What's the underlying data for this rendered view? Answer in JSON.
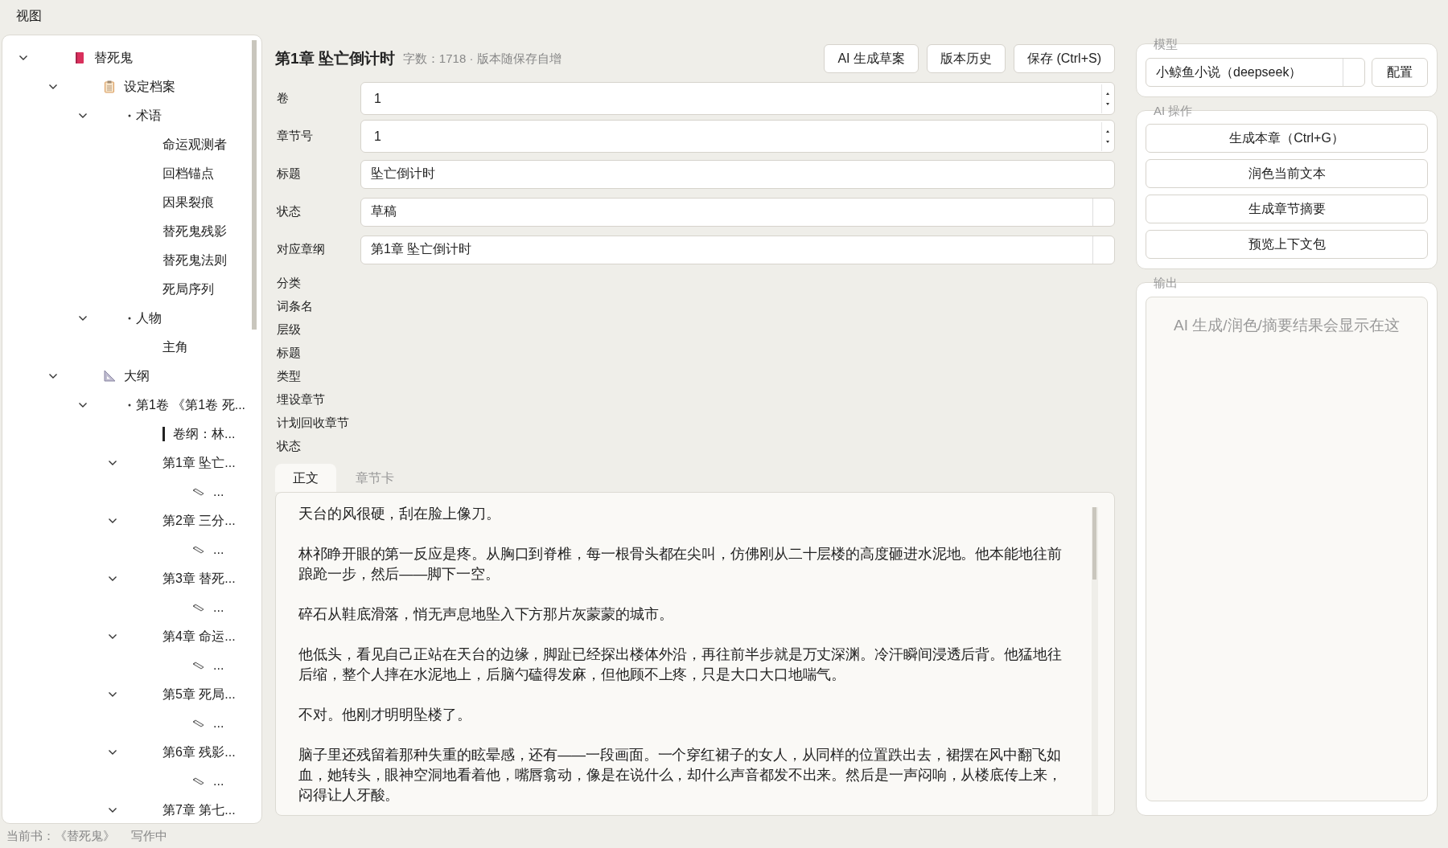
{
  "menu": [
    "视图"
  ],
  "sidebar": {
    "tree": [
      {
        "label": "替死鬼",
        "kind": "book",
        "expanded": true,
        "children": [
          {
            "label": "设定档案",
            "kind": "archive",
            "expanded": true,
            "children": [
              {
                "label": "术语",
                "kind": "group",
                "expanded": true,
                "children": [
                  {
                    "label": "命运观测者"
                  },
                  {
                    "label": "回档锚点"
                  },
                  {
                    "label": "因果裂痕"
                  },
                  {
                    "label": "替死鬼残影"
                  },
                  {
                    "label": "替死鬼法则"
                  },
                  {
                    "label": "死局序列"
                  }
                ]
              },
              {
                "label": "人物",
                "kind": "group",
                "expanded": true,
                "children": [
                  {
                    "label": "主角"
                  }
                ]
              }
            ]
          },
          {
            "label": "大纲",
            "kind": "outline",
            "expanded": true,
            "children": [
              {
                "label": "第1卷 《第1卷 死...",
                "kind": "group",
                "expanded": true,
                "children": [
                  {
                    "label": "卷纲：林...",
                    "kind": "synopsis"
                  },
                  {
                    "label": "第1章 坠亡...",
                    "expanded": true,
                    "children": [
                      {
                        "label": "...",
                        "kind": "note"
                      }
                    ]
                  },
                  {
                    "label": "第2章 三分...",
                    "expanded": true,
                    "children": [
                      {
                        "label": "...",
                        "kind": "note"
                      }
                    ]
                  },
                  {
                    "label": "第3章 替死...",
                    "expanded": true,
                    "children": [
                      {
                        "label": "...",
                        "kind": "note"
                      }
                    ]
                  },
                  {
                    "label": "第4章 命运...",
                    "expanded": true,
                    "children": [
                      {
                        "label": "...",
                        "kind": "note"
                      }
                    ]
                  },
                  {
                    "label": "第5章 死局...",
                    "expanded": true,
                    "children": [
                      {
                        "label": "...",
                        "kind": "note"
                      }
                    ]
                  },
                  {
                    "label": "第6章 残影...",
                    "expanded": true,
                    "children": [
                      {
                        "label": "...",
                        "kind": "note"
                      }
                    ]
                  },
                  {
                    "label": "第7章 第七...",
                    "expanded": true
                  }
                ]
              }
            ]
          }
        ]
      }
    ]
  },
  "editor": {
    "title": "第1章 坠亡倒计时",
    "meta": "字数：1718 · 版本随保存自增",
    "buttons": [
      "AI 生成草案",
      "版本历史",
      "保存 (Ctrl+S)"
    ],
    "fields": [
      {
        "label": "卷",
        "kind": "number",
        "value": "1"
      },
      {
        "label": "章节号",
        "kind": "number",
        "value": "1"
      },
      {
        "label": "标题",
        "kind": "text",
        "value": "坠亡倒计时"
      },
      {
        "label": "状态",
        "kind": "select",
        "value": "草稿"
      },
      {
        "label": "对应章纲",
        "kind": "select",
        "value": "第1章 坠亡倒计时"
      }
    ],
    "card_labels": [
      "分类",
      "词条名",
      "层级",
      "标题",
      "类型",
      "埋设章节",
      "计划回收章节",
      "状态"
    ],
    "tabs": [
      {
        "label": "正文",
        "selected": true
      },
      {
        "label": "章节卡",
        "selected": false
      }
    ],
    "body": [
      "天台的风很硬，刮在脸上像刀。",
      "林祁睁开眼的第一反应是疼。从胸口到脊椎，每一根骨头都在尖叫，仿佛刚从二十层楼的高度砸进水泥地。他本能地往前踉跄一步，然后——脚下一空。",
      "碎石从鞋底滑落，悄无声息地坠入下方那片灰蒙蒙的城市。",
      "他低头，看见自己正站在天台的边缘，脚趾已经探出楼体外沿，再往前半步就是万丈深渊。冷汗瞬间浸透后背。他猛地往后缩，整个人摔在水泥地上，后脑勺磕得发麻，但他顾不上疼，只是大口大口地喘气。",
      "不对。他刚才明明坠楼了。",
      "脑子里还残留着那种失重的眩晕感，还有——一段画面。一个穿红裙子的女人，从同样的位置跌出去，裙摆在风中翻飞如血，她转头，眼神空洞地看着他，嘴唇翕动，像是在说什么，却什么声音都发不出来。然后是一声闷响，从楼底传上来，闷得让人牙酸。"
    ]
  },
  "right": {
    "model": {
      "title": "模型",
      "value": "小鲸鱼小说（deepseek）",
      "button": "配置"
    },
    "actions": {
      "title": "AI 操作",
      "buttons": [
        "生成本章（Ctrl+G）",
        "润色当前文本",
        "生成章节摘要",
        "预览上下文包"
      ]
    },
    "output": {
      "title": "输出",
      "placeholder": "AI 生成/润色/摘要结果会显示在这"
    }
  },
  "status_bar": {
    "book": "当前书：《替死鬼》",
    "state": "写作中"
  }
}
